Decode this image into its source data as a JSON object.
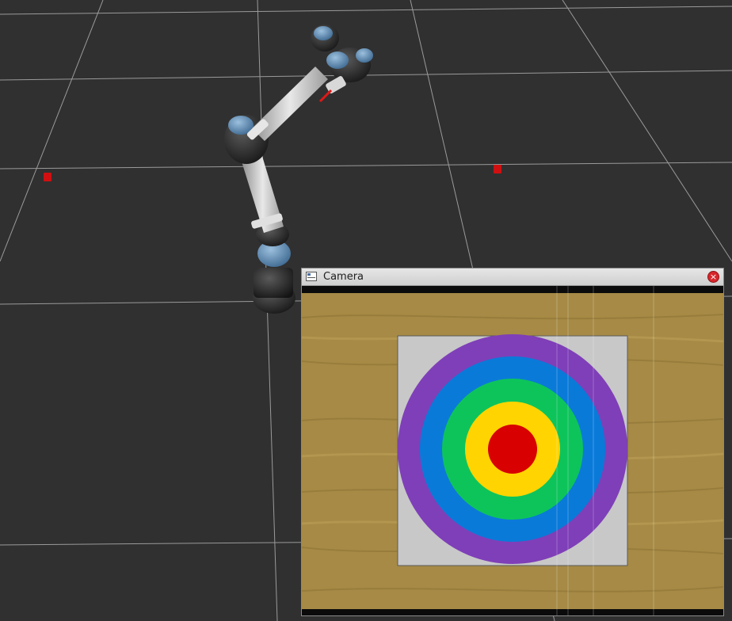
{
  "scene": {
    "background_color": "#303030",
    "grid_color": "#9a9a9a",
    "marker_color": "#d01010"
  },
  "camera_window": {
    "title": "Camera",
    "close_glyph": "×",
    "icons": {
      "title": "window-icon",
      "close": "close-icon"
    }
  },
  "camera_image": {
    "floor_color": "#a68a45",
    "board_color": "#c8c8c8",
    "target_rings": [
      {
        "color": "#7f3fb8"
      },
      {
        "color": "#0a7ad9"
      },
      {
        "color": "#0dc45b"
      },
      {
        "color": "#ffd400"
      },
      {
        "color": "#d80000"
      }
    ]
  },
  "robot": {
    "link_color": "#c9c9c9",
    "joint_color": "#2a2a2a",
    "cap_color": "#5b86ad"
  }
}
